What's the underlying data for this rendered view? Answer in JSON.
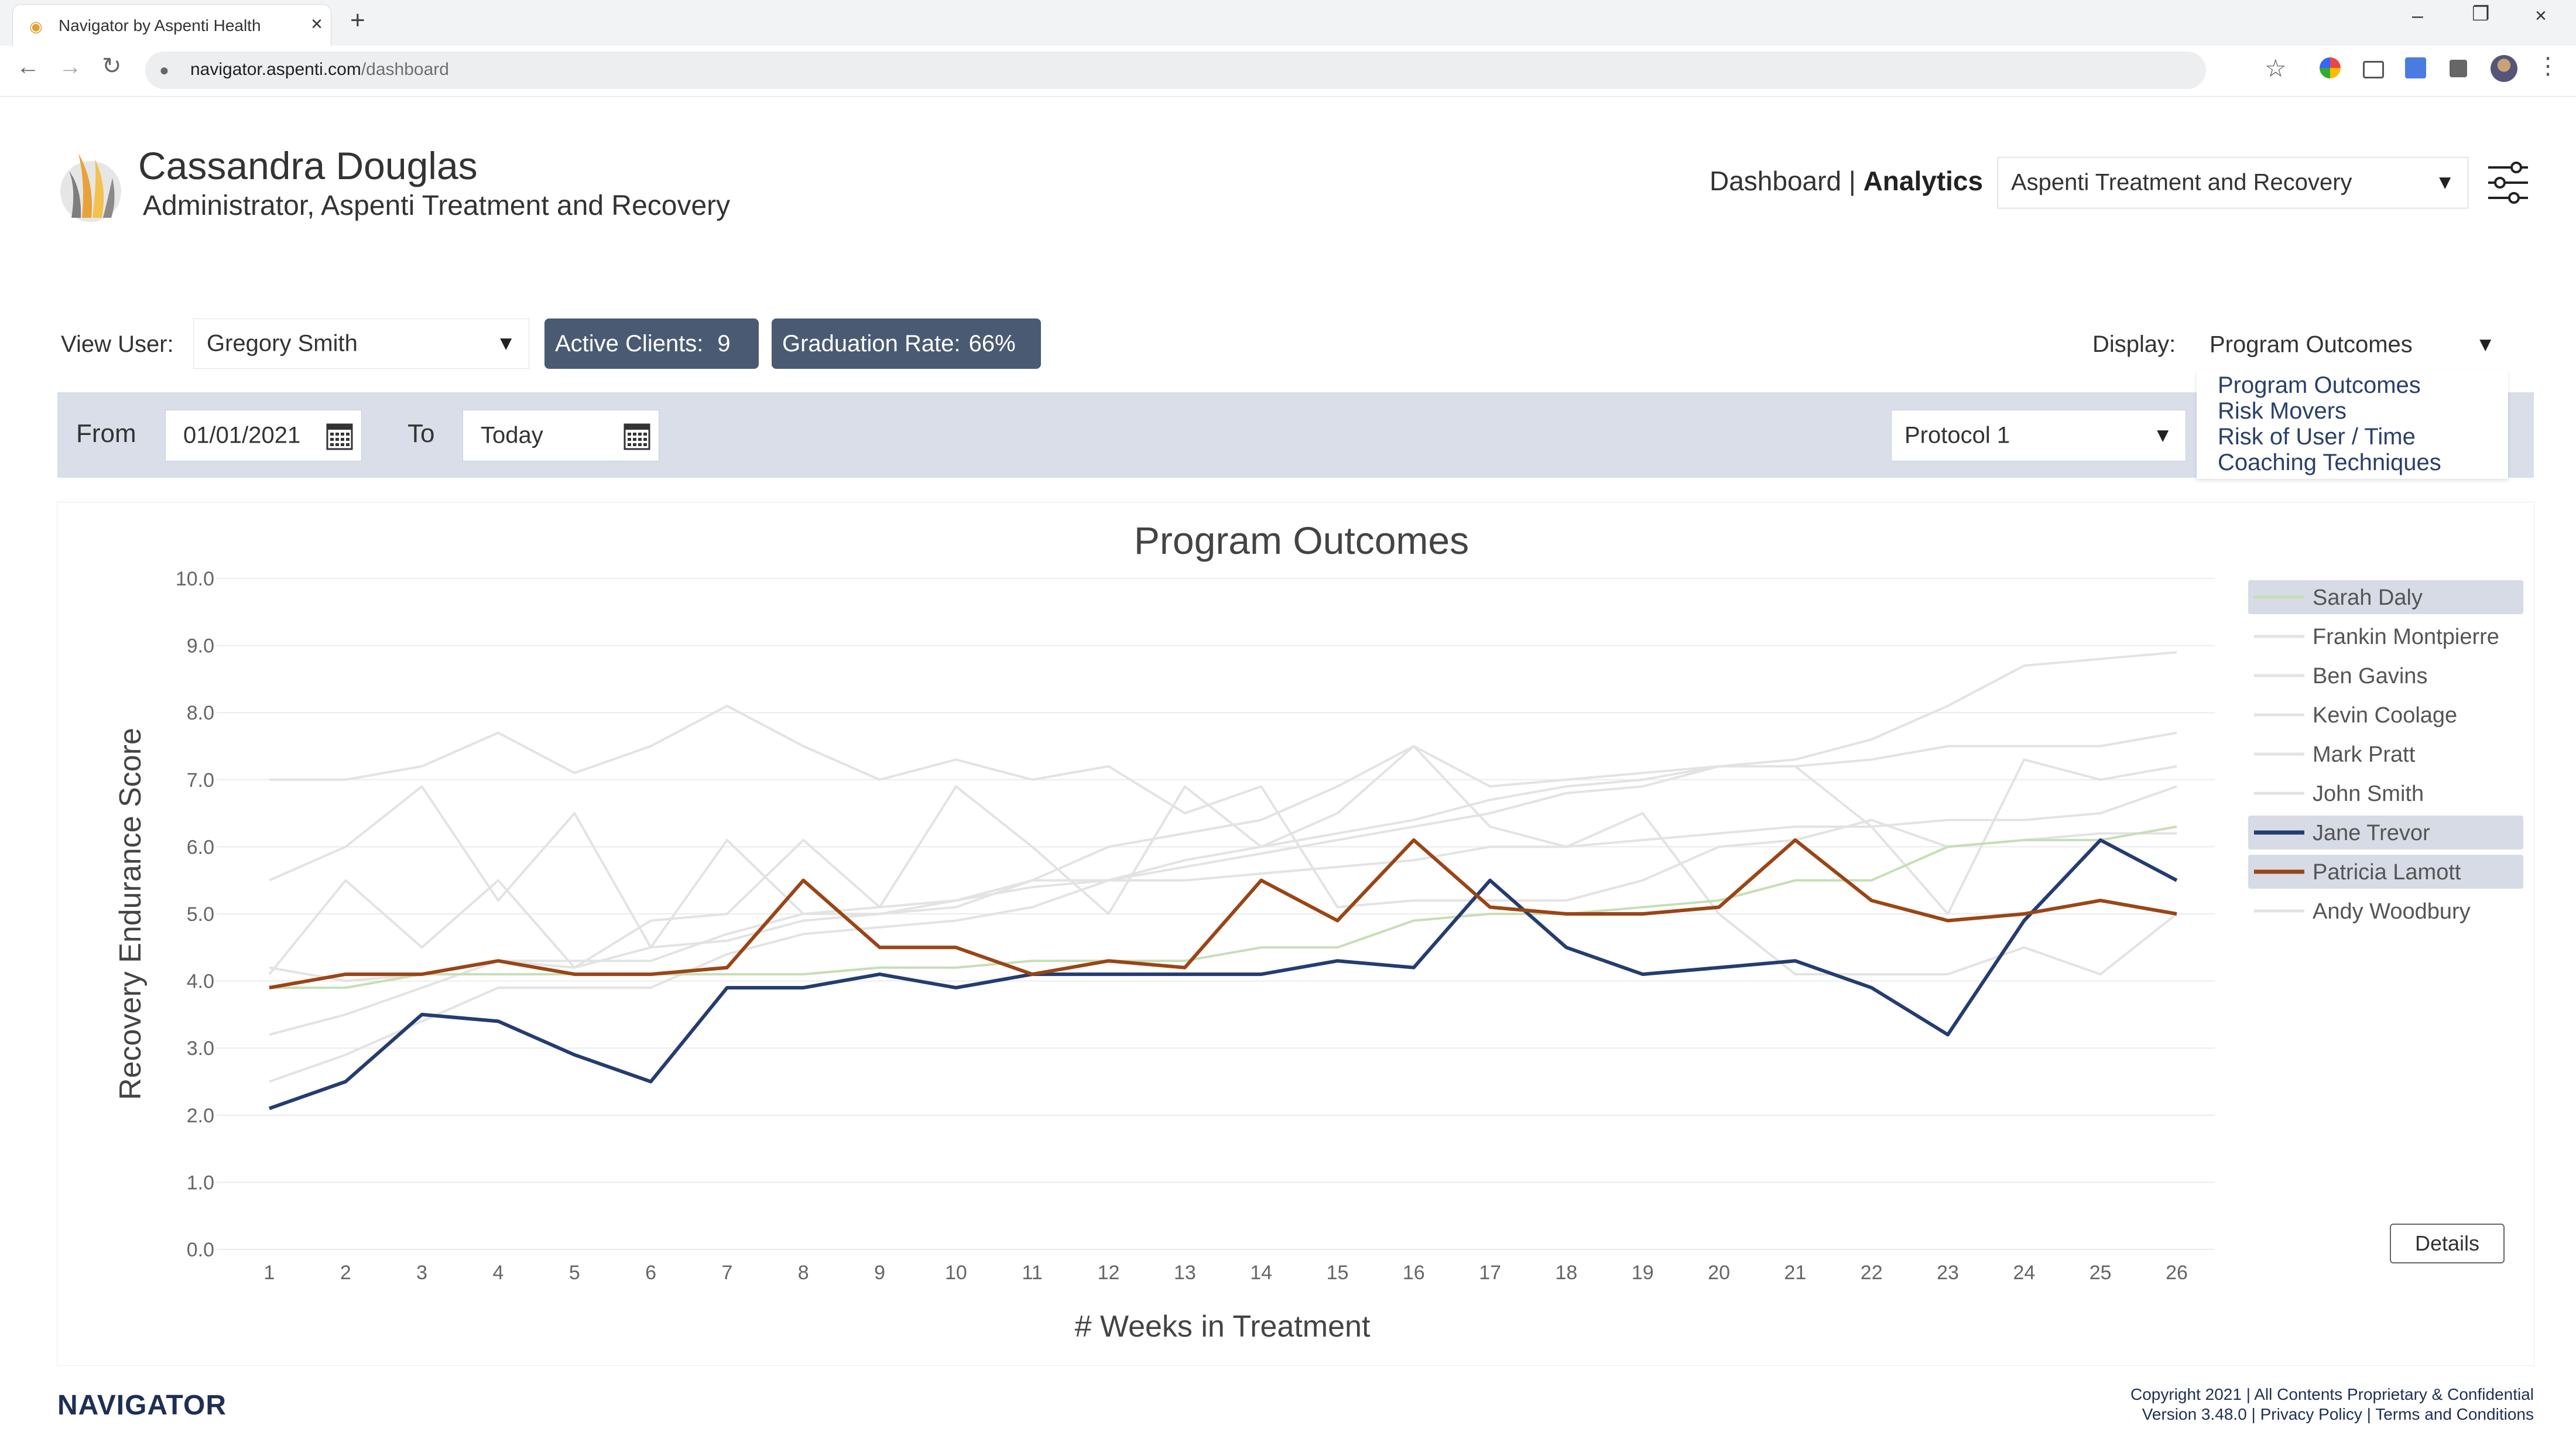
{
  "browser": {
    "tab_title": "Navigator by Aspenti Health",
    "url_host": "navigator.aspenti.com",
    "url_path": "/dashboard"
  },
  "header": {
    "user_name": "Cassandra Douglas",
    "user_role": "Administrator, Aspenti Treatment and Recovery",
    "nav_dashboard": "Dashboard",
    "nav_separator": "|",
    "nav_analytics": "Analytics",
    "org_select_value": "Aspenti Treatment and Recovery"
  },
  "filters": {
    "view_user_label": "View User:",
    "view_user_value": "Gregory Smith",
    "active_clients_label": "Active Clients:",
    "active_clients_value": "9",
    "graduation_rate_label": "Graduation Rate:",
    "graduation_rate_value": "66%",
    "display_label": "Display:",
    "display_value": "Program Outcomes",
    "display_options": [
      "Program Outcomes",
      "Risk Movers",
      "Risk of User / Time",
      "Coaching Techniques"
    ],
    "from_label": "From",
    "from_value": "01/01/2021",
    "to_label": "To",
    "to_value": "Today",
    "protocol_value": "Protocol 1"
  },
  "details_label": "Details",
  "footer": {
    "brand": "NAVIGATOR",
    "copyright": "Copyright 2021 | All Contents Proprietary & Confidential",
    "version_line": "Version 3.48.0 | Privacy Policy | Terms and Conditions"
  },
  "colors": {
    "badge_bg": "#4a5a72",
    "date_bar_bg": "#d9dee8",
    "dropdown_text": "#2a3f6a",
    "footer_text": "#1e2f55",
    "gray_series": "#e3e3e3",
    "legend_highlight": "#d6dbe5"
  },
  "chart_data": {
    "type": "line",
    "title": "Program Outcomes",
    "xlabel": "# Weeks in Treatment",
    "ylabel": "Recovery Endurance Score",
    "x": [
      1,
      2,
      3,
      4,
      5,
      6,
      7,
      8,
      9,
      10,
      11,
      12,
      13,
      14,
      15,
      16,
      17,
      18,
      19,
      20,
      21,
      22,
      23,
      24,
      25,
      26
    ],
    "ylim": [
      0,
      10
    ],
    "yticks": [
      "0.0",
      "1.0",
      "2.0",
      "3.0",
      "4.0",
      "5.0",
      "6.0",
      "7.0",
      "8.0",
      "9.0",
      "10.0"
    ],
    "grid": true,
    "legend_position": "right",
    "series": [
      {
        "name": "Sarah Daly",
        "color": "#c5dfb5",
        "highlight": true,
        "values": [
          3.9,
          3.9,
          4.1,
          4.1,
          4.1,
          4.1,
          4.1,
          4.1,
          4.2,
          4.2,
          4.3,
          4.3,
          4.3,
          4.5,
          4.5,
          4.9,
          5.0,
          5.0,
          5.1,
          5.2,
          5.5,
          5.5,
          6.0,
          6.1,
          6.1,
          6.3
        ]
      },
      {
        "name": "Frankin Montpierre",
        "color": "#e3e3e3",
        "highlight": false,
        "values": [
          5.5,
          6.0,
          6.9,
          5.2,
          6.5,
          4.5,
          6.1,
          5.0,
          5.1,
          5.2,
          5.5,
          6.0,
          6.2,
          6.4,
          6.9,
          7.5,
          6.3,
          6.0,
          6.5,
          5.0,
          4.1,
          4.1,
          4.1,
          4.5,
          4.1,
          5.0
        ]
      },
      {
        "name": "Ben Gavins",
        "color": "#e3e3e3",
        "highlight": false,
        "values": [
          7.0,
          7.0,
          7.2,
          7.7,
          7.1,
          7.5,
          8.1,
          7.5,
          7.0,
          7.3,
          7.0,
          7.2,
          6.5,
          6.9,
          5.1,
          5.2,
          5.2,
          5.2,
          5.5,
          6.0,
          6.1,
          6.4,
          6.0,
          6.1,
          6.2,
          6.2
        ]
      },
      {
        "name": "Kevin Coolage",
        "color": "#e3e3e3",
        "highlight": false,
        "values": [
          4.1,
          5.5,
          4.5,
          5.5,
          4.2,
          4.9,
          5.0,
          6.1,
          5.1,
          6.9,
          6.0,
          5.0,
          6.9,
          6.0,
          6.5,
          7.5,
          6.9,
          7.0,
          7.1,
          7.2,
          7.2,
          6.3,
          5.0,
          7.3,
          7.0,
          7.2
        ]
      },
      {
        "name": "Mark Pratt",
        "color": "#e3e3e3",
        "highlight": false,
        "values": [
          3.2,
          3.5,
          3.9,
          4.3,
          4.3,
          4.3,
          4.7,
          5.0,
          5.0,
          5.1,
          5.5,
          5.5,
          5.8,
          6.0,
          6.2,
          6.4,
          6.7,
          6.9,
          7.0,
          7.2,
          7.3,
          7.6,
          8.1,
          8.7,
          8.8,
          8.9
        ]
      },
      {
        "name": "John Smith",
        "color": "#e3e3e3",
        "highlight": false,
        "values": [
          2.5,
          2.9,
          3.4,
          3.9,
          3.9,
          3.9,
          4.4,
          4.7,
          4.8,
          4.9,
          5.1,
          5.5,
          5.7,
          5.9,
          6.1,
          6.3,
          6.5,
          6.8,
          6.9,
          7.2,
          7.2,
          7.3,
          7.5,
          7.5,
          7.5,
          7.7
        ]
      },
      {
        "name": "Jane Trevor",
        "color": "#243c70",
        "highlight": true,
        "values": [
          2.1,
          2.5,
          3.5,
          3.4,
          2.9,
          2.5,
          3.9,
          3.9,
          4.1,
          3.9,
          4.1,
          4.1,
          4.1,
          4.1,
          4.3,
          4.2,
          5.5,
          4.5,
          4.1,
          4.2,
          4.3,
          3.9,
          3.2,
          4.9,
          6.1,
          5.5
        ]
      },
      {
        "name": "Patricia Lamott",
        "color": "#9a4516",
        "highlight": true,
        "values": [
          3.9,
          4.1,
          4.1,
          4.3,
          4.1,
          4.1,
          4.2,
          5.5,
          4.5,
          4.5,
          4.1,
          4.3,
          4.2,
          5.5,
          4.9,
          6.1,
          5.1,
          5.0,
          5.0,
          5.1,
          6.1,
          5.2,
          4.9,
          5.0,
          5.2,
          5.0
        ]
      },
      {
        "name": "Andy Woodbury",
        "color": "#e3e3e3",
        "highlight": false,
        "values": [
          4.2,
          4.0,
          4.1,
          4.3,
          4.2,
          4.5,
          4.6,
          4.9,
          5.0,
          5.2,
          5.4,
          5.5,
          5.5,
          5.6,
          5.7,
          5.8,
          6.0,
          6.0,
          6.1,
          6.2,
          6.3,
          6.3,
          6.4,
          6.4,
          6.5,
          6.9
        ]
      }
    ]
  }
}
